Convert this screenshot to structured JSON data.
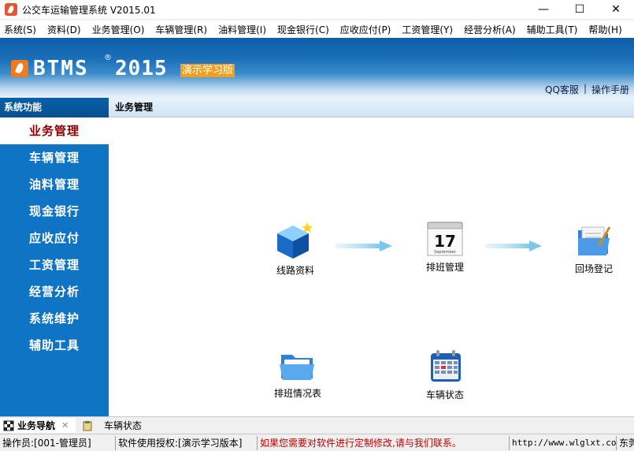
{
  "window": {
    "title": "公交车运输管理系统 V2015.01",
    "min_glyph": "—",
    "max_glyph": "☐",
    "close_glyph": "✕"
  },
  "menu": [
    "系统(S)",
    "资料(D)",
    "业务管理(O)",
    "车辆管理(R)",
    "油料管理(I)",
    "现金银行(C)",
    "应收应付(P)",
    "工资管理(Y)",
    "经营分析(A)",
    "辅助工具(T)",
    "帮助(H)"
  ],
  "banner": {
    "logo_text": "BTMS",
    "logo_reg": "®",
    "logo_year": "2015",
    "edition": "演示学习版",
    "links": [
      "QQ客服",
      "操作手册"
    ],
    "link_sep": "|"
  },
  "sidebar": {
    "header": "系统功能",
    "items": [
      "业务管理",
      "车辆管理",
      "油料管理",
      "现金银行",
      "应收应付",
      "工资管理",
      "经营分析",
      "系统维护",
      "辅助工具"
    ],
    "active_index": 0
  },
  "main": {
    "header": "业务管理",
    "nodes": [
      {
        "label": "线路资料",
        "icon": "cube-icon"
      },
      {
        "label": "排班管理",
        "icon": "calendar-icon"
      },
      {
        "label": "回场登记",
        "icon": "folder-edit-icon"
      },
      {
        "label": "排班情况表",
        "icon": "folder-icon"
      },
      {
        "label": "车辆状态",
        "icon": "calendar-grid-icon"
      }
    ],
    "calendar_day": "17",
    "calendar_month": "September"
  },
  "tabs": [
    {
      "label": "业务导航",
      "active": true
    },
    {
      "label": "车辆状态",
      "active": false
    }
  ],
  "status": {
    "operator": "操作员:[001-管理员]",
    "license": "软件使用授权:[演示学习版本]",
    "notice": "如果您需要对软件进行定制修改,请与我们联系。",
    "url": "http://www.wlglxt.com",
    "trail": "东莞"
  },
  "colors": {
    "sidebar": "#0f74c4",
    "active_text": "#8b0000",
    "edition_bg": "#f0a020",
    "notice": "#c00000"
  }
}
